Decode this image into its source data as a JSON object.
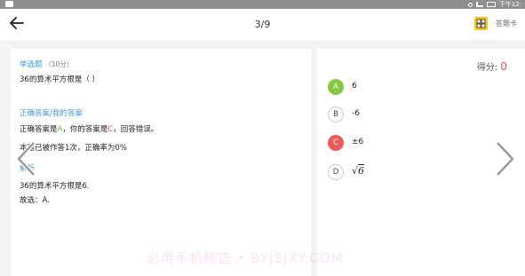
{
  "status_bar": {
    "time": "下午12:"
  },
  "header": {
    "page_indicator": "3/9",
    "answer_card_label": "答题卡"
  },
  "question": {
    "type_label": "单选题",
    "points": "（10分）",
    "text": "36的算术平方根是（        ）"
  },
  "answer_section": {
    "title": "正确答案/我的答案",
    "prefix": "正确答案是",
    "correct": "A",
    "middle": "，你的答案是",
    "mine": "C",
    "suffix": "，回答错误。",
    "stats": "本题已被作答1次，正确率为0%"
  },
  "analysis": {
    "title": "解析",
    "line1": "36的算术平方根是6.",
    "line2": "故选：A."
  },
  "score": {
    "label": "得分: ",
    "value": "0"
  },
  "options": [
    {
      "letter": "A",
      "text": "6",
      "state": "correct"
    },
    {
      "letter": "B",
      "text": "-6",
      "state": "none"
    },
    {
      "letter": "C",
      "text": "±6",
      "state": "wrong"
    },
    {
      "letter": "D",
      "text_radical": "√",
      "text_radicand": "6",
      "state": "none"
    }
  ],
  "watermark": "必用手机精选 • BYJSJXY.COM",
  "colors": {
    "accent_blue": "#3f9ae0",
    "correct_green": "#86c93f",
    "wrong_red": "#ee5a5a",
    "answer_card_icon": "#f5c518"
  },
  "icons": {
    "back": "arrow-left-icon",
    "answer_card": "answer-card-icon",
    "prev": "chevron-left-icon",
    "next": "chevron-right-icon"
  }
}
